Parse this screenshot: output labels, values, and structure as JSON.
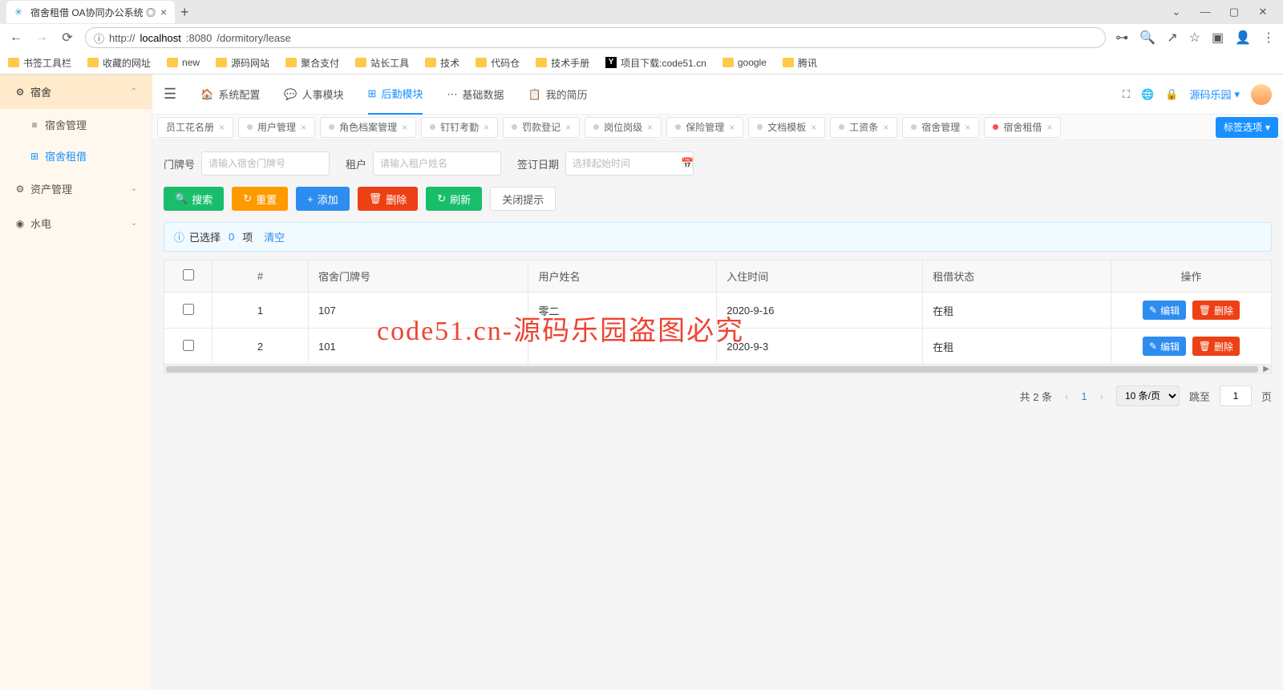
{
  "browser": {
    "tab_title": "宿舍租借 OA协同办公系统 ◎",
    "url_prefix": "http://",
    "url_host": "localhost",
    "url_port": ":8080",
    "url_path": "/dormitory/lease",
    "bookmarks": [
      "书签工具栏",
      "收藏的网址",
      "new",
      "源码网站",
      "聚合支付",
      "站长工具",
      "技术",
      "代码仓",
      "技术手册",
      "项目下载:code51.cn",
      "google",
      "腾讯"
    ]
  },
  "sidebar": {
    "groups": [
      {
        "label": "宿舍",
        "icon": "⚙",
        "open": true,
        "items": [
          {
            "label": "宿舍管理",
            "active": false
          },
          {
            "label": "宿舍租借",
            "active": true
          }
        ]
      },
      {
        "label": "资产管理",
        "icon": "⚙",
        "open": false
      },
      {
        "label": "水电",
        "icon": "◉",
        "open": false
      }
    ]
  },
  "topnav": {
    "items": [
      {
        "label": "系统配置",
        "icon": "🏠"
      },
      {
        "label": "人事模块",
        "icon": "💬"
      },
      {
        "label": "后勤模块",
        "icon": "⊞",
        "active": true
      },
      {
        "label": "基础数据",
        "icon": "⋯"
      },
      {
        "label": "我的简历",
        "icon": "📋"
      }
    ],
    "user": "源码乐园"
  },
  "page_tabs": {
    "items": [
      "员工花名册",
      "用户管理",
      "角色档案管理",
      "钉钉考勤",
      "罚款登记",
      "岗位岗级",
      "保险管理",
      "文档模板",
      "工资条",
      "宿舍管理",
      "宿舍租借"
    ],
    "active_index": 10,
    "options_label": "标签选项"
  },
  "search": {
    "door_label": "门牌号",
    "door_placeholder": "请输入宿舍门牌号",
    "tenant_label": "租户",
    "tenant_placeholder": "请输入租户姓名",
    "date_label": "签订日期",
    "date_placeholder": "选择起始时间"
  },
  "buttons": {
    "search": "搜索",
    "reset": "重置",
    "add": "添加",
    "delete": "删除",
    "refresh": "刷新",
    "close_tip": "关闭提示"
  },
  "alert": {
    "prefix": "已选择",
    "count": "0",
    "suffix": "项",
    "clear": "清空"
  },
  "table": {
    "headers": [
      "#",
      "宿舍门牌号",
      "用户姓名",
      "入住时间",
      "租借状态",
      "操作"
    ],
    "rows": [
      {
        "idx": "1",
        "door": "107",
        "name": "零二",
        "date": "2020-9-16",
        "status": "在租"
      },
      {
        "idx": "2",
        "door": "101",
        "name": "",
        "date": "2020-9-3",
        "status": "在租"
      }
    ],
    "edit_label": "编辑",
    "delete_label": "删除"
  },
  "pager": {
    "total": "共 2 条",
    "current": "1",
    "size": "10 条/页",
    "goto": "跳至",
    "page_suffix": "页",
    "goto_value": "1"
  },
  "watermark": "code51.cn-源码乐园盗图必究"
}
